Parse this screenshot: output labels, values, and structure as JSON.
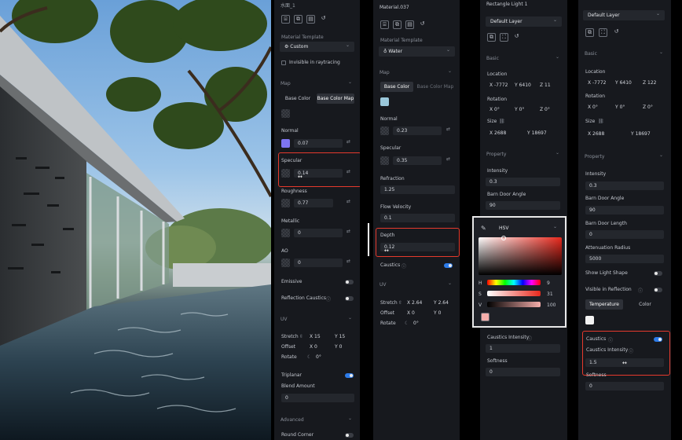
{
  "panel1": {
    "title": "水面_1",
    "material_template_label": "Material Template",
    "template_value": "Custom",
    "invisible_raytracing": "Invisible in raytracing",
    "map_section": "Map",
    "tab_base_color": "Base Color",
    "tab_base_color_map": "Base Color Map",
    "normal_label": "Normal",
    "normal_value": "0.07",
    "specular_label": "Specular",
    "specular_value": "0.14",
    "roughness_label": "Roughness",
    "roughness_value": "0.77",
    "metallic_label": "Metallic",
    "metallic_value": "0",
    "ao_label": "AO",
    "ao_value": "0",
    "emissive_label": "Emissive",
    "reflection_caustics_label": "Reflection Caustics",
    "uv_section": "UV",
    "stretch_label": "Stretch",
    "stretch_x": "X 15",
    "stretch_y": "Y 15",
    "offset_label": "Offset",
    "offset_x": "X 0",
    "offset_y": "Y 0",
    "rotate_label": "Rotate",
    "rotate_value": "0°",
    "triplanar_label": "Triplanar",
    "blend_amount_label": "Blend Amount",
    "blend_amount_value": "0",
    "advanced_section": "Advanced",
    "round_corner_label": "Round Corner"
  },
  "panel2": {
    "title": "Material.037",
    "material_template_label": "Material Template",
    "template_value": "Water",
    "map_section": "Map",
    "tab_base_color": "Base Color",
    "tab_base_color_map": "Base Color Map",
    "normal_label": "Normal",
    "normal_value": "0.23",
    "specular_label": "Specular",
    "specular_value": "0.35",
    "refraction_label": "Refraction",
    "refraction_value": "1.25",
    "flow_velocity_label": "Flow Velocity",
    "flow_velocity_value": "0.1",
    "depth_label": "Depth",
    "depth_value": "0.12",
    "caustics_label": "Caustics",
    "uv_section": "UV",
    "stretch_label": "Stretch",
    "stretch_x": "X 2.64",
    "stretch_y": "Y 2.64",
    "offset_label": "Offset",
    "offset_x": "X 0",
    "offset_y": "Y 0",
    "rotate_label": "Rotate",
    "rotate_value": "0°"
  },
  "panel3": {
    "title": "Rectangle Light 1",
    "layer_value": "Default Layer",
    "basic_section": "Basic",
    "location_label": "Location",
    "loc_x": "X -7772",
    "loc_y": "Y 6410",
    "loc_z": "Z 11",
    "rotation_label": "Rotation",
    "rot_x": "X 0°",
    "rot_y": "Y 0°",
    "rot_z": "Z 0°",
    "size_label": "Size",
    "size_x": "X 2688",
    "size_y": "Y 18697",
    "property_section": "Property",
    "intensity_label": "Intensity",
    "intensity_value": "0.3",
    "barn_door_angle_label": "Barn Door Angle",
    "barn_door_angle_value": "90",
    "caustics_intensity_label": "Caustics Intensity",
    "caustics_intensity_value": "1",
    "softness_label": "Softness",
    "softness_value": "0"
  },
  "color_picker": {
    "mode": "HSV",
    "h_label": "H",
    "h_value": "9",
    "s_label": "S",
    "s_value": "31",
    "v_label": "V",
    "v_value": "100",
    "hue_color": "#e8281c",
    "preview_color": "#f5aeab"
  },
  "panel4": {
    "layer_value": "Default Layer",
    "basic_section": "Basic",
    "location_label": "Location",
    "loc_x": "X -7772",
    "loc_y": "Y 6410",
    "loc_z": "Z 122",
    "rotation_label": "Rotation",
    "rot_x": "X 0°",
    "rot_y": "Y 0°",
    "rot_z": "Z 0°",
    "size_label": "Size",
    "size_x": "X 2688",
    "size_y": "Y 18697",
    "property_section": "Property",
    "intensity_label": "Intensity",
    "intensity_value": "0.3",
    "barn_door_angle_label": "Barn Door Angle",
    "barn_door_angle_value": "90",
    "barn_door_length_label": "Barn Door Length",
    "barn_door_length_value": "0",
    "attenuation_radius_label": "Attenuation Radius",
    "attenuation_radius_value": "5000",
    "show_light_shape_label": "Show Light Shape",
    "visible_in_reflection_label": "Visible in Reflection",
    "tab_temperature": "Temperature",
    "tab_color": "Color",
    "caustics_label": "Caustics",
    "caustics_intensity_label": "Caustics Intensity",
    "caustics_intensity_value": "1.5",
    "softness_label": "Softness",
    "softness_value": "0"
  },
  "colors": {
    "accent": "#2d7be8",
    "highlight": "#e53a2c",
    "panel_bg": "#17191e"
  }
}
